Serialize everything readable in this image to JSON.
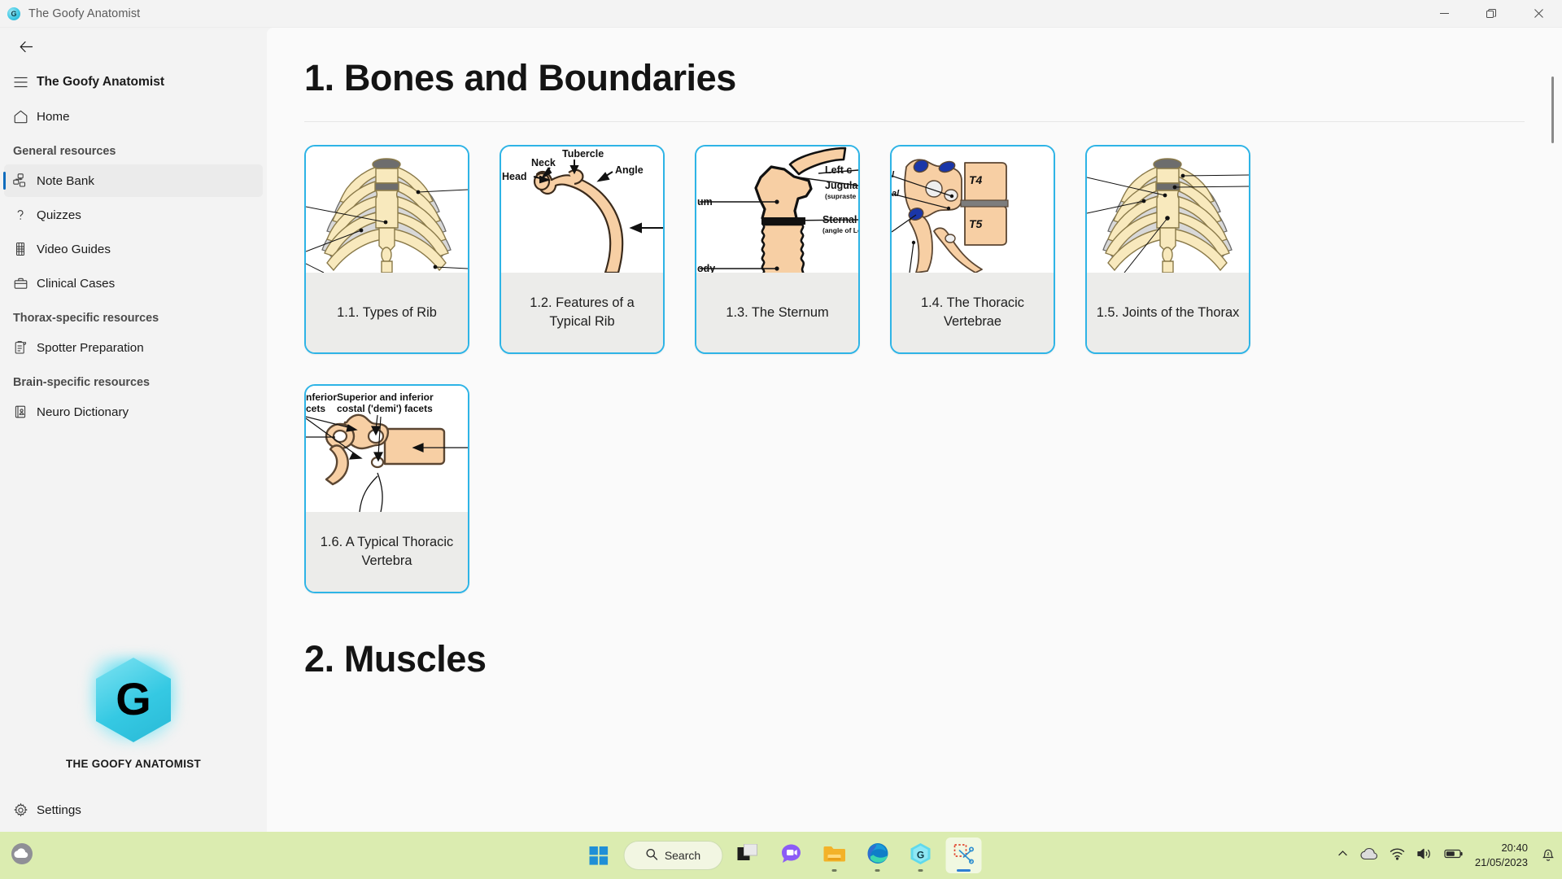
{
  "window": {
    "app_icon": "goofy-anatomist-logo-icon",
    "title": "The Goofy Anatomist",
    "minimize_label": "Minimize",
    "restore_label": "Restore",
    "close_label": "Close"
  },
  "sidebar": {
    "back_label": "Back",
    "menu_icon": "hamburger-menu-icon",
    "app_name": "The Goofy Anatomist",
    "home": {
      "label": "Home",
      "icon": "home-icon"
    },
    "sections": [
      {
        "heading": "General resources",
        "items": [
          {
            "label": "Note Bank",
            "icon": "note-bank-icon",
            "selected": true
          },
          {
            "label": "Quizzes",
            "icon": "question-mark-icon",
            "selected": false
          },
          {
            "label": "Video Guides",
            "icon": "film-strip-icon",
            "selected": false
          },
          {
            "label": "Clinical Cases",
            "icon": "briefcase-icon",
            "selected": false
          }
        ]
      },
      {
        "heading": "Thorax-specific resources",
        "items": [
          {
            "label": "Spotter Preparation",
            "icon": "clipboard-icon",
            "selected": false
          }
        ]
      },
      {
        "heading": "Brain-specific resources",
        "items": [
          {
            "label": "Neuro Dictionary",
            "icon": "book-contact-icon",
            "selected": false
          }
        ]
      }
    ],
    "logo": {
      "letter": "G",
      "caption": "THE GOOFY ANATOMIST"
    },
    "settings": {
      "label": "Settings",
      "icon": "gear-icon"
    }
  },
  "main": {
    "sections": [
      {
        "title": "1. Bones and Boundaries",
        "cards": [
          {
            "label": "1.1. Types of Rib",
            "thumb": "rib-cage-diagram"
          },
          {
            "label": "1.2. Features of a Typical Rib",
            "thumb": "typical-rib-diagram"
          },
          {
            "label": "1.3. The Sternum",
            "thumb": "sternum-diagram"
          },
          {
            "label": "1.4. The Thoracic Vertebrae",
            "thumb": "thoracic-vertebrae-diagram"
          },
          {
            "label": "1.5. Joints of the Thorax",
            "thumb": "thorax-joints-diagram"
          },
          {
            "label": "1.6. A Typical Thoracic Vertebra",
            "thumb": "typical-thoracic-vertebra-diagram"
          }
        ]
      },
      {
        "title": "2. Muscles",
        "cards": []
      }
    ],
    "thumb_labels": {
      "rib": {
        "neck": "Neck",
        "tubercle": "Tubercle",
        "head": "Head",
        "angle": "Angle"
      },
      "sternum": {
        "left": "Left c",
        "jugular": "Jugula",
        "jugular_sub": "(supraste",
        "manubrium": "um",
        "sternal": "Sternal s",
        "sternal_sub": "(angle of Louis",
        "body": "ody"
      },
      "vertebrae": {
        "t4": "T4",
        "t5": "T5",
        "label1": "l",
        "label2": "al"
      },
      "vertebra": {
        "line1": "nferior",
        "line2": "cets",
        "title1": "Superior and inferior",
        "title2": "costal ('demi') facets"
      }
    }
  },
  "taskbar": {
    "weather_icon": "cloud-weather-icon",
    "start_icon": "windows-start-icon",
    "search": {
      "label": "Search",
      "icon": "search-icon"
    },
    "apps": [
      {
        "name": "task-view",
        "icon": "task-view-icon",
        "running": false,
        "active": false
      },
      {
        "name": "chat",
        "icon": "chat-bubble-icon",
        "running": false,
        "active": false
      },
      {
        "name": "file-explorer",
        "icon": "folder-icon",
        "running": true,
        "active": false
      },
      {
        "name": "microsoft-edge",
        "icon": "edge-icon",
        "running": true,
        "active": false
      },
      {
        "name": "goofy-anatomist",
        "icon": "goofy-anatomist-icon",
        "running": true,
        "active": false
      },
      {
        "name": "snipping-tool",
        "icon": "scissors-icon",
        "running": true,
        "active": true
      }
    ],
    "tray": {
      "chevron_icon": "chevron-up-icon",
      "onedrive_icon": "cloud-icon",
      "wifi_icon": "wifi-icon",
      "volume_icon": "speaker-icon",
      "battery_icon": "battery-icon",
      "notification_icon": "bell-dnd-icon"
    },
    "clock": {
      "time": "20:40",
      "date": "21/05/2023"
    }
  },
  "colors": {
    "accent_card_border": "#2eb4e6",
    "selected_indicator": "#0f6cbd",
    "taskbar_bg": "#dbecb0",
    "sidebar_bg": "#f3f3f3",
    "content_bg": "#fafafa"
  }
}
